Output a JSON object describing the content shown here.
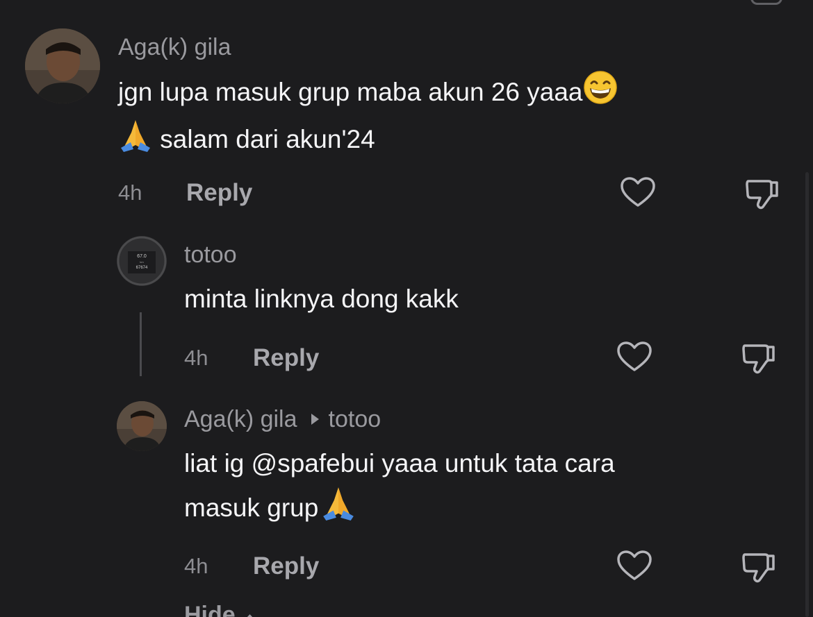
{
  "comments": [
    {
      "author": "Aga(k) gila",
      "lines": [
        "jgn lupa masuk grup maba akun 26 yaaa",
        "salam dari akun'24"
      ],
      "time": "4h",
      "reply_label": "Reply"
    },
    {
      "author": "totoo",
      "avatar_text": [
        "67.0",
        "km",
        "67674"
      ],
      "lines": [
        "minta linknya dong kakk"
      ],
      "time": "4h",
      "reply_label": "Reply"
    },
    {
      "author": "Aga(k) gila",
      "reply_to": "totoo",
      "lines": [
        "liat ig @spafebui yaaa untuk tata cara",
        "masuk grup"
      ],
      "time": "4h",
      "reply_label": "Reply"
    }
  ],
  "hide_label": "Hide",
  "icons": {
    "like": "heart-icon",
    "dislike": "thumbs-down-icon",
    "emoji_grin": "grinning-face-emoji",
    "emoji_pray": "folded-hands-emoji"
  },
  "colors": {
    "background": "#1c1c1e",
    "text": "#f5f5f7",
    "muted": "#9a9a9f"
  }
}
